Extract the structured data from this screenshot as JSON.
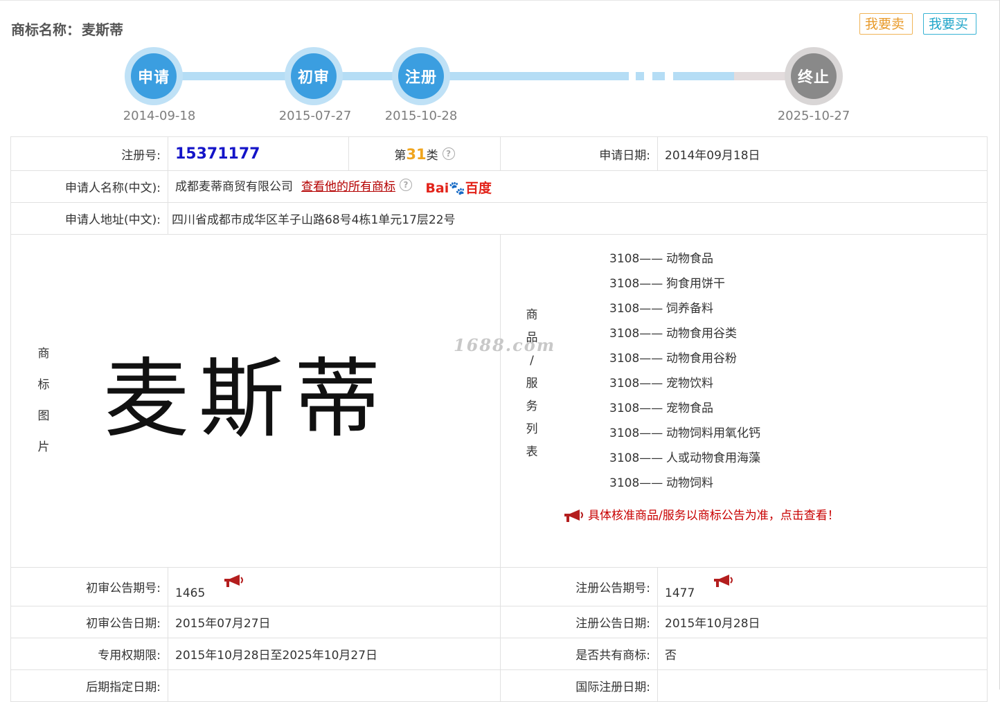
{
  "header": {
    "title_label": "商标名称：",
    "title_value": "麦斯蒂",
    "sell_button": "我要卖",
    "buy_button": "我要买"
  },
  "timeline": {
    "steps": [
      {
        "label": "申请",
        "date": "2014-09-18"
      },
      {
        "label": "初审",
        "date": "2015-07-27"
      },
      {
        "label": "注册",
        "date": "2015-10-28"
      },
      {
        "label": "终止",
        "date": "2025-10-27"
      }
    ]
  },
  "info": {
    "reg_no_label": "注册号:",
    "reg_no": "15371177",
    "class_prefix": "第",
    "class_num": "31",
    "class_suffix": "类",
    "apply_date_label": "申请日期:",
    "apply_date": "2014年09月18日",
    "applicant_label": "申请人名称(中文):",
    "applicant": "成都麦蒂商贸有限公司",
    "view_all_link": "查看他的所有商标",
    "baidu_bai": "Bai",
    "baidu_du": "du",
    "baidu_cn": "百度",
    "address_label": "申请人地址(中文):",
    "address": "四川省成都市成华区羊子山路68号4栋1单元17层22号",
    "mark_image_label": [
      "商",
      "标",
      "图",
      "片"
    ],
    "mark_image_text": "麦斯蒂",
    "goods_label": [
      "商",
      "品",
      "/",
      "服",
      "务",
      "列",
      "表"
    ],
    "goods": [
      {
        "code": "3108——",
        "name": "动物食品"
      },
      {
        "code": "3108——",
        "name": "狗食用饼干"
      },
      {
        "code": "3108——",
        "name": "饲养备料"
      },
      {
        "code": "3108——",
        "name": "动物食用谷类"
      },
      {
        "code": "3108——",
        "name": "动物食用谷粉"
      },
      {
        "code": "3108——",
        "name": "宠物饮料"
      },
      {
        "code": "3108——",
        "name": "宠物食品"
      },
      {
        "code": "3108——",
        "name": "动物饲料用氧化钙"
      },
      {
        "code": "3108——",
        "name": "人或动物食用海藻"
      },
      {
        "code": "3108——",
        "name": "动物饲料"
      }
    ],
    "goods_notice": "具体核准商品/服务以商标公告为准，点击查看！",
    "watermark": "1688.com",
    "prelim_no_label": "初审公告期号:",
    "prelim_no": "1465",
    "reg_pub_no_label": "注册公告期号:",
    "reg_pub_no": "1477",
    "prelim_date_label": "初审公告日期:",
    "prelim_date": "2015年07月27日",
    "reg_pub_date_label": "注册公告日期:",
    "reg_pub_date": "2015年10月28日",
    "term_label": "专用权期限:",
    "term": "2015年10月28日至2025年10月27日",
    "shared_label": "是否共有商标:",
    "shared": "否",
    "later_date_label": "后期指定日期:",
    "intl_date_label": "国际注册日期:"
  },
  "colors": {
    "timeline_blue": "#3b9ee0",
    "timeline_grey": "#898989",
    "reg_no_blue": "#1414c8",
    "class_orange": "#f0a51e",
    "link_red": "#b40000"
  }
}
